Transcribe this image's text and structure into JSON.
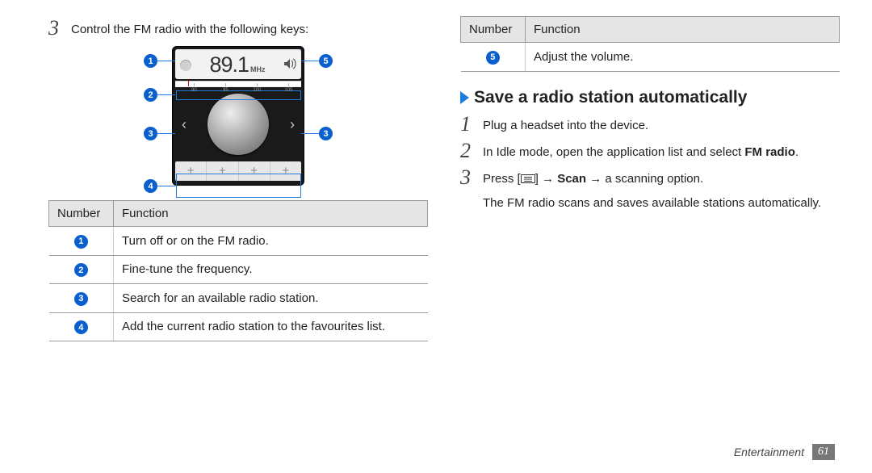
{
  "left": {
    "step3_num": "3",
    "step3_text": "Control the FM radio with the following keys:",
    "radio": {
      "frequency": "89.1",
      "unit": "MHz",
      "scale_labels": [
        "90",
        "95",
        "100",
        "105"
      ],
      "preset_glyph": "+"
    },
    "callouts": {
      "c1": "1",
      "c2": "2",
      "c3l": "3",
      "c3r": "3",
      "c4": "4",
      "c5": "5"
    },
    "table": {
      "headers": [
        "Number",
        "Function"
      ],
      "rows": [
        {
          "n": "1",
          "f": "Turn off or on the FM radio."
        },
        {
          "n": "2",
          "f": "Fine-tune the frequency."
        },
        {
          "n": "3",
          "f": "Search for an available radio station."
        },
        {
          "n": "4",
          "f": "Add the current radio station to the favourites list."
        }
      ]
    }
  },
  "right": {
    "table": {
      "headers": [
        "Number",
        "Function"
      ],
      "rows": [
        {
          "n": "5",
          "f": "Adjust the volume."
        }
      ]
    },
    "section_title": "Save a radio station automatically",
    "steps": {
      "s1_num": "1",
      "s1": "Plug a headset into the device.",
      "s2_num": "2",
      "s2_a": "In Idle mode, open the application list and select ",
      "s2_b": "FM radio",
      "s2_c": ".",
      "s3_num": "3",
      "s3_a": "Press [",
      "s3_b": "] → ",
      "s3_scan": "Scan",
      "s3_c": " → a scanning option.",
      "s3_sub": "The FM radio scans and saves available stations automatically."
    }
  },
  "footer": {
    "chapter": "Entertainment",
    "page": "61"
  }
}
